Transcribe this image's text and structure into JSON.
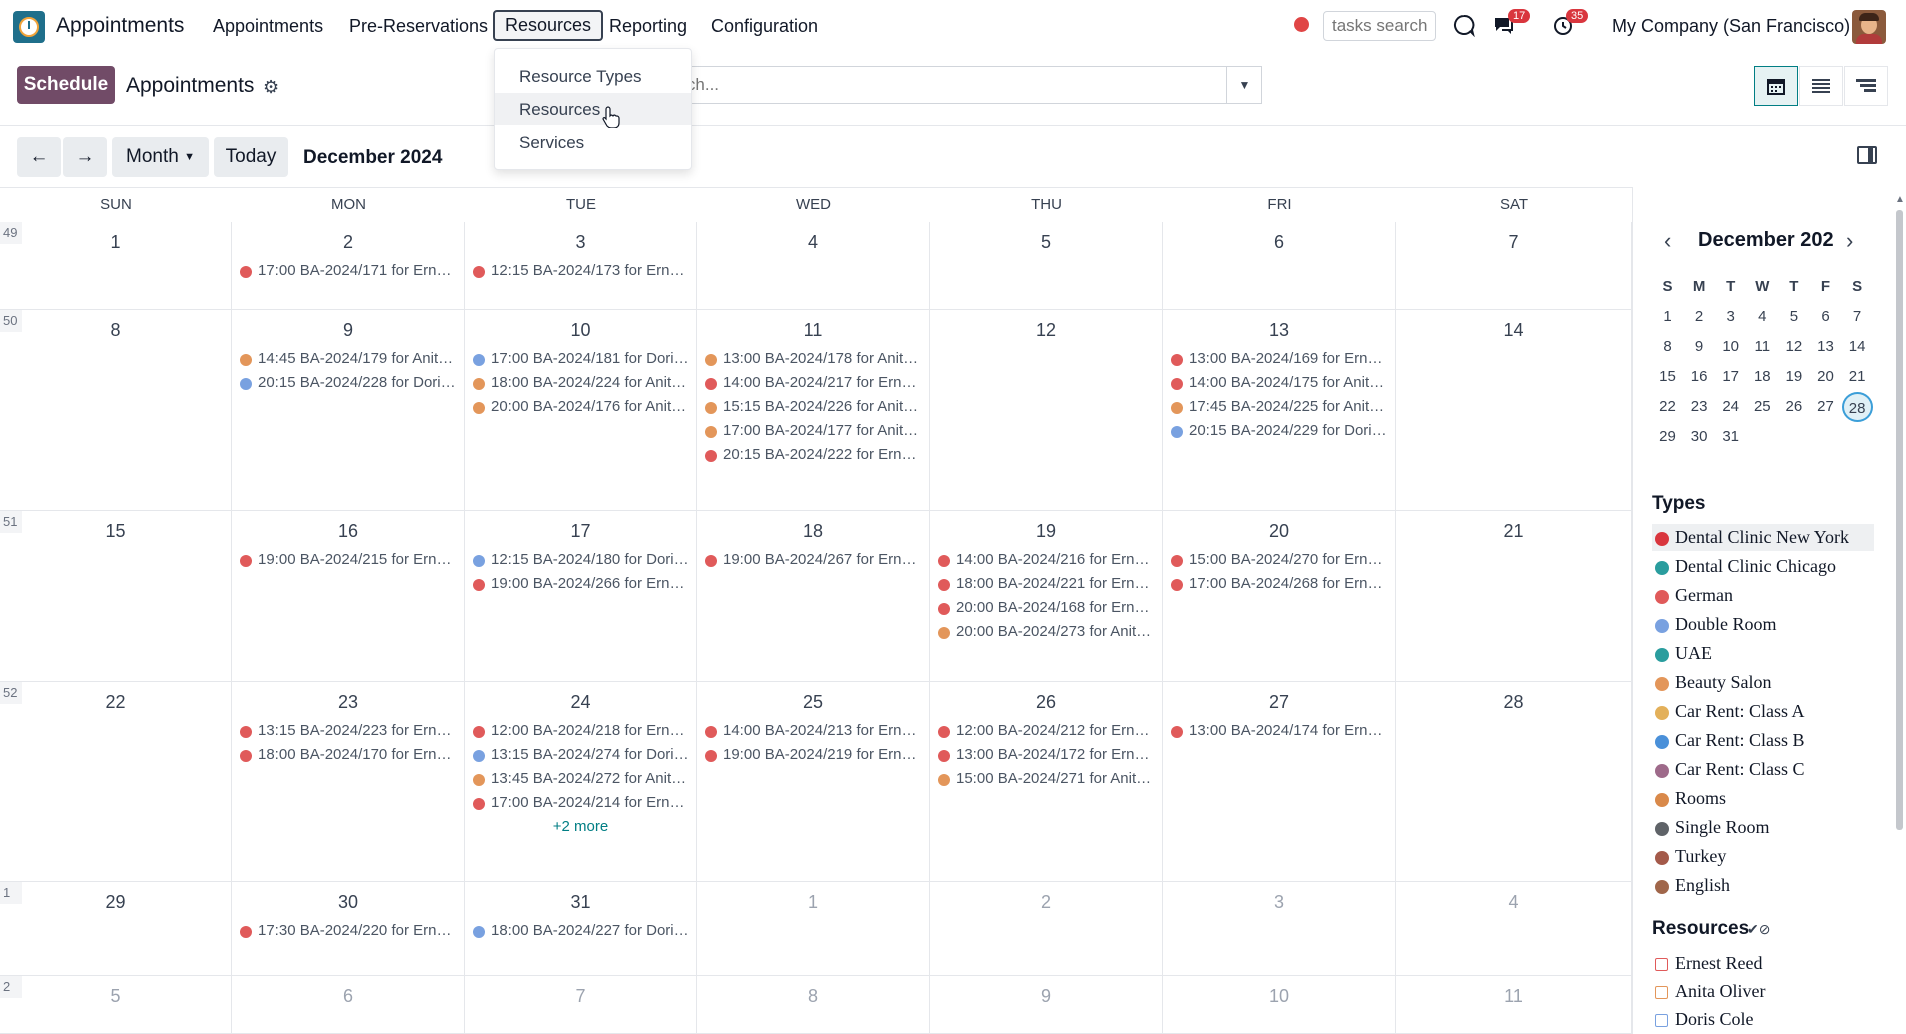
{
  "navbar": {
    "app_name": "Appointments",
    "menu": [
      "Appointments",
      "Pre-Reservations",
      "Resources",
      "Reporting",
      "Configuration"
    ],
    "tasks_search_placeholder": "tasks search",
    "messages_count": "17",
    "activities_count": "35",
    "company": "My Company (San Francisco)"
  },
  "dropdown": {
    "items": [
      "Resource Types",
      "Resources",
      "Services"
    ]
  },
  "control": {
    "schedule_label": "Schedule",
    "title": "Appointments",
    "search_placeholder": "Search...",
    "scale_label": "Month",
    "today_label": "Today",
    "period": "December 2024"
  },
  "calendar": {
    "day_names": [
      "SUN",
      "MON",
      "TUE",
      "WED",
      "THU",
      "FRI",
      "SAT"
    ],
    "weeks": [
      {
        "num": "49",
        "days": [
          {
            "d": "1",
            "events": []
          },
          {
            "d": "2",
            "events": [
              {
                "t": "17:00 BA-2024/171 for Ernes...",
                "c": "#e05a5a"
              }
            ]
          },
          {
            "d": "3",
            "events": [
              {
                "t": "12:15 BA-2024/173 for Ernes...",
                "c": "#e05a5a"
              }
            ]
          },
          {
            "d": "4",
            "events": []
          },
          {
            "d": "5",
            "events": []
          },
          {
            "d": "6",
            "events": []
          },
          {
            "d": "7",
            "events": []
          }
        ]
      },
      {
        "num": "50",
        "days": [
          {
            "d": "8",
            "events": []
          },
          {
            "d": "9",
            "events": [
              {
                "t": "14:45 BA-2024/179 for Anita...",
                "c": "#e3965a"
              },
              {
                "t": "20:15 BA-2024/228 for Doris...",
                "c": "#79a1e0"
              }
            ]
          },
          {
            "d": "10",
            "events": [
              {
                "t": "17:00 BA-2024/181 for Doris...",
                "c": "#79a1e0"
              },
              {
                "t": "18:00 BA-2024/224 for Anita...",
                "c": "#e3965a"
              },
              {
                "t": "20:00 BA-2024/176 for Anita...",
                "c": "#e3965a"
              }
            ]
          },
          {
            "d": "11",
            "events": [
              {
                "t": "13:00 BA-2024/178 for Anita...",
                "c": "#e3965a"
              },
              {
                "t": "14:00 BA-2024/217 for Ernes...",
                "c": "#e05a5a"
              },
              {
                "t": "15:15 BA-2024/226 for Anita...",
                "c": "#e3965a"
              },
              {
                "t": "17:00 BA-2024/177 for Anita...",
                "c": "#e3965a"
              },
              {
                "t": "20:15 BA-2024/222 for Ernes...",
                "c": "#e05a5a"
              }
            ]
          },
          {
            "d": "12",
            "events": []
          },
          {
            "d": "13",
            "events": [
              {
                "t": "13:00 BA-2024/169 for Ernes...",
                "c": "#e05a5a"
              },
              {
                "t": "14:00 BA-2024/175 for Anita...",
                "c": "#e05a5a"
              },
              {
                "t": "17:45 BA-2024/225 for Anita...",
                "c": "#e3965a"
              },
              {
                "t": "20:15 BA-2024/229 for Doris...",
                "c": "#79a1e0"
              }
            ]
          },
          {
            "d": "14",
            "events": []
          }
        ]
      },
      {
        "num": "51",
        "days": [
          {
            "d": "15",
            "events": []
          },
          {
            "d": "16",
            "events": [
              {
                "t": "19:00 BA-2024/215 for Ernes...",
                "c": "#e05a5a"
              }
            ]
          },
          {
            "d": "17",
            "events": [
              {
                "t": "12:15 BA-2024/180 for Doris...",
                "c": "#79a1e0"
              },
              {
                "t": "19:00 BA-2024/266 for Ernes...",
                "c": "#e05a5a"
              }
            ]
          },
          {
            "d": "18",
            "events": [
              {
                "t": "19:00 BA-2024/267 for Ernes...",
                "c": "#e05a5a"
              }
            ]
          },
          {
            "d": "19",
            "events": [
              {
                "t": "14:00 BA-2024/216 for Ernes...",
                "c": "#e05a5a"
              },
              {
                "t": "18:00 BA-2024/221 for Ernes...",
                "c": "#e05a5a"
              },
              {
                "t": "20:00 BA-2024/168 for Ernes...",
                "c": "#e05a5a"
              },
              {
                "t": "20:00 BA-2024/273 for Anita...",
                "c": "#e3965a"
              }
            ]
          },
          {
            "d": "20",
            "events": [
              {
                "t": "15:00 BA-2024/270 for Ernes...",
                "c": "#e05a5a"
              },
              {
                "t": "17:00 BA-2024/268 for Ernes...",
                "c": "#e05a5a"
              }
            ]
          },
          {
            "d": "21",
            "events": []
          }
        ]
      },
      {
        "num": "52",
        "days": [
          {
            "d": "22",
            "events": []
          },
          {
            "d": "23",
            "events": [
              {
                "t": "13:15 BA-2024/223 for Ernes...",
                "c": "#e05a5a"
              },
              {
                "t": "18:00 BA-2024/170 for Ernes...",
                "c": "#e05a5a"
              }
            ]
          },
          {
            "d": "24",
            "events": [
              {
                "t": "12:00 BA-2024/218 for Ernes...",
                "c": "#e05a5a"
              },
              {
                "t": "13:15 BA-2024/274 for Doris...",
                "c": "#79a1e0"
              },
              {
                "t": "13:45 BA-2024/272 for Anita...",
                "c": "#e3965a"
              },
              {
                "t": "17:00 BA-2024/214 for Ernes...",
                "c": "#e05a5a"
              }
            ],
            "more": "+2 more"
          },
          {
            "d": "25",
            "events": [
              {
                "t": "14:00 BA-2024/213 for Ernes...",
                "c": "#e05a5a"
              },
              {
                "t": "19:00 BA-2024/219 for Ernes...",
                "c": "#e05a5a"
              }
            ]
          },
          {
            "d": "26",
            "events": [
              {
                "t": "12:00 BA-2024/212 for Ernes...",
                "c": "#e05a5a"
              },
              {
                "t": "13:00 BA-2024/172 for Ernes...",
                "c": "#e05a5a"
              },
              {
                "t": "15:00 BA-2024/271 for Anita...",
                "c": "#e3965a"
              }
            ]
          },
          {
            "d": "27",
            "events": [
              {
                "t": "13:00 BA-2024/174 for Ernes...",
                "c": "#e05a5a"
              }
            ]
          },
          {
            "d": "28",
            "events": []
          }
        ]
      },
      {
        "num": "1",
        "days": [
          {
            "d": "29",
            "events": []
          },
          {
            "d": "30",
            "events": [
              {
                "t": "17:30 BA-2024/220 for Ernes...",
                "c": "#e05a5a"
              }
            ]
          },
          {
            "d": "31",
            "events": [
              {
                "t": "18:00 BA-2024/227 for Doris...",
                "c": "#79a1e0"
              }
            ]
          },
          {
            "d": "1",
            "muted": true,
            "events": []
          },
          {
            "d": "2",
            "muted": true,
            "events": []
          },
          {
            "d": "3",
            "muted": true,
            "events": []
          },
          {
            "d": "4",
            "muted": true,
            "events": []
          }
        ]
      },
      {
        "num": "2",
        "days": [
          {
            "d": "5",
            "muted": true,
            "events": []
          },
          {
            "d": "6",
            "muted": true,
            "events": []
          },
          {
            "d": "7",
            "muted": true,
            "events": []
          },
          {
            "d": "8",
            "muted": true,
            "events": []
          },
          {
            "d": "9",
            "muted": true,
            "events": []
          },
          {
            "d": "10",
            "muted": true,
            "events": []
          },
          {
            "d": "11",
            "muted": true,
            "events": []
          }
        ]
      }
    ]
  },
  "mini_calendar": {
    "title": "December 202",
    "dow": [
      "S",
      "M",
      "T",
      "W",
      "T",
      "F",
      "S"
    ],
    "rows": [
      [
        "1",
        "2",
        "3",
        "4",
        "5",
        "6",
        "7"
      ],
      [
        "8",
        "9",
        "10",
        "11",
        "12",
        "13",
        "14"
      ],
      [
        "15",
        "16",
        "17",
        "18",
        "19",
        "20",
        "21"
      ],
      [
        "22",
        "23",
        "24",
        "25",
        "26",
        "27",
        "28"
      ],
      [
        "29",
        "30",
        "31"
      ]
    ],
    "today": "28"
  },
  "types": {
    "title": "Types",
    "items": [
      {
        "label": "Dental Clinic New York",
        "color": "#d9363e"
      },
      {
        "label": "Dental Clinic Chicago",
        "color": "#2a9d9e"
      },
      {
        "label": "German",
        "color": "#e05a5a"
      },
      {
        "label": "Double Room",
        "color": "#79a1e0"
      },
      {
        "label": "UAE",
        "color": "#2a9d9e"
      },
      {
        "label": "Beauty Salon",
        "color": "#e3965a"
      },
      {
        "label": "Car Rent: Class A",
        "color": "#e3b05a"
      },
      {
        "label": "Car Rent: Class B",
        "color": "#4a90d9"
      },
      {
        "label": "Car Rent: Class C",
        "color": "#9e6a8a"
      },
      {
        "label": "Rooms",
        "color": "#d9894a"
      },
      {
        "label": "Single Room",
        "color": "#5f6368"
      },
      {
        "label": "Turkey",
        "color": "#a45a4a"
      },
      {
        "label": "English",
        "color": "#a0664a"
      }
    ]
  },
  "resources": {
    "title": "Resources",
    "items": [
      {
        "label": "Ernest Reed",
        "color": "#e05a5a"
      },
      {
        "label": "Anita Oliver",
        "color": "#e3965a"
      },
      {
        "label": "Doris Cole",
        "color": "#79a1e0"
      }
    ]
  }
}
